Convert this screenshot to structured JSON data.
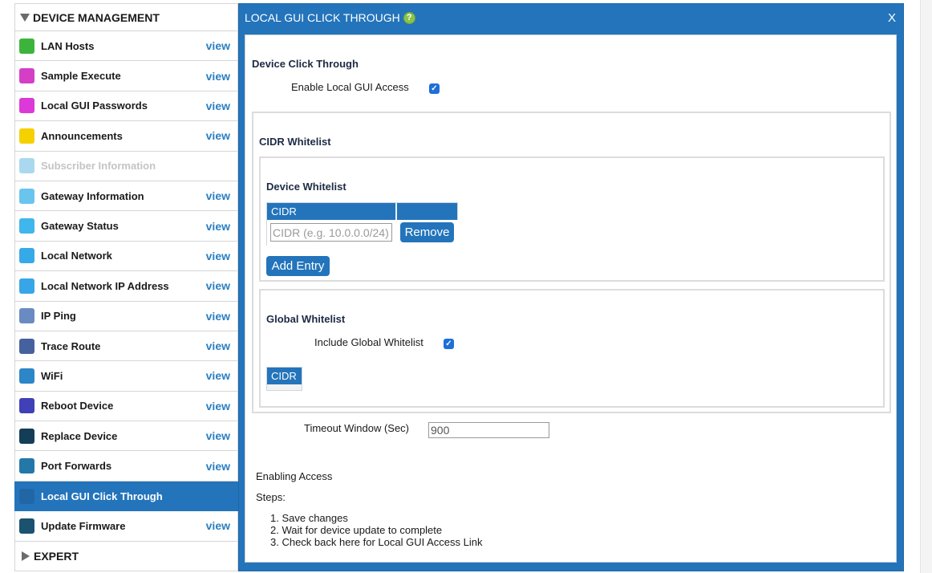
{
  "sidebar": {
    "device_management_label": "DEVICE MANAGEMENT",
    "expert_label": "EXPERT",
    "view_label": "view",
    "items": [
      {
        "label": "LAN Hosts",
        "color": "#3cb43c",
        "view": true
      },
      {
        "label": "Sample Execute",
        "color": "#d43fc6",
        "view": true
      },
      {
        "label": "Local GUI Passwords",
        "color": "#dd38d8",
        "view": true
      },
      {
        "label": "Announcements",
        "color": "#f5d100",
        "view": true
      },
      {
        "label": "Subscriber Information",
        "color": "#a9d8f0",
        "view": false,
        "disabled": true
      },
      {
        "label": "Gateway Information",
        "color": "#69c5ee",
        "view": true
      },
      {
        "label": "Gateway Status",
        "color": "#3fb6ec",
        "view": true
      },
      {
        "label": "Local Network",
        "color": "#36a9e8",
        "view": true
      },
      {
        "label": "Local Network IP Address",
        "color": "#36a6e8",
        "view": true
      },
      {
        "label": "IP Ping",
        "color": "#6a8ac2",
        "view": true
      },
      {
        "label": "Trace Route",
        "color": "#46629e",
        "view": true
      },
      {
        "label": "WiFi",
        "color": "#2c86c8",
        "view": true
      },
      {
        "label": "Reboot Device",
        "color": "#4040b8",
        "view": true
      },
      {
        "label": "Replace Device",
        "color": "#143d58",
        "view": true
      },
      {
        "label": "Port Forwards",
        "color": "#2478a8",
        "view": true
      },
      {
        "label": "Local GUI Click Through",
        "color": "#2167a6",
        "view": false,
        "active": true
      },
      {
        "label": "Update Firmware",
        "color": "#1b5270",
        "view": true
      }
    ]
  },
  "dialog": {
    "title": "LOCAL GUI CLICK THROUGH",
    "help_icon": "?",
    "close_label": "X",
    "device_click_through_heading": "Device Click Through",
    "enable_local_gui_label": "Enable Local GUI Access",
    "enable_local_gui_checked": true,
    "cidr_whitelist_heading": "CIDR Whitelist",
    "device_whitelist_heading": "Device Whitelist",
    "device_table_header": "CIDR",
    "cidr_placeholder": "CIDR (e.g. 10.0.0.0/24)",
    "remove_label": "Remove",
    "add_entry_label": "Add Entry",
    "global_whitelist_heading": "Global Whitelist",
    "include_global_label": "Include Global Whitelist",
    "include_global_checked": true,
    "global_table_header": "CIDR",
    "timeout_label": "Timeout Window (Sec)",
    "timeout_value": "900",
    "enabling_access_heading": "Enabling Access",
    "steps_label": "Steps:",
    "steps": [
      "1. Save changes",
      "2. Wait for device update to complete",
      "3. Check back here for Local GUI Access Link"
    ]
  }
}
